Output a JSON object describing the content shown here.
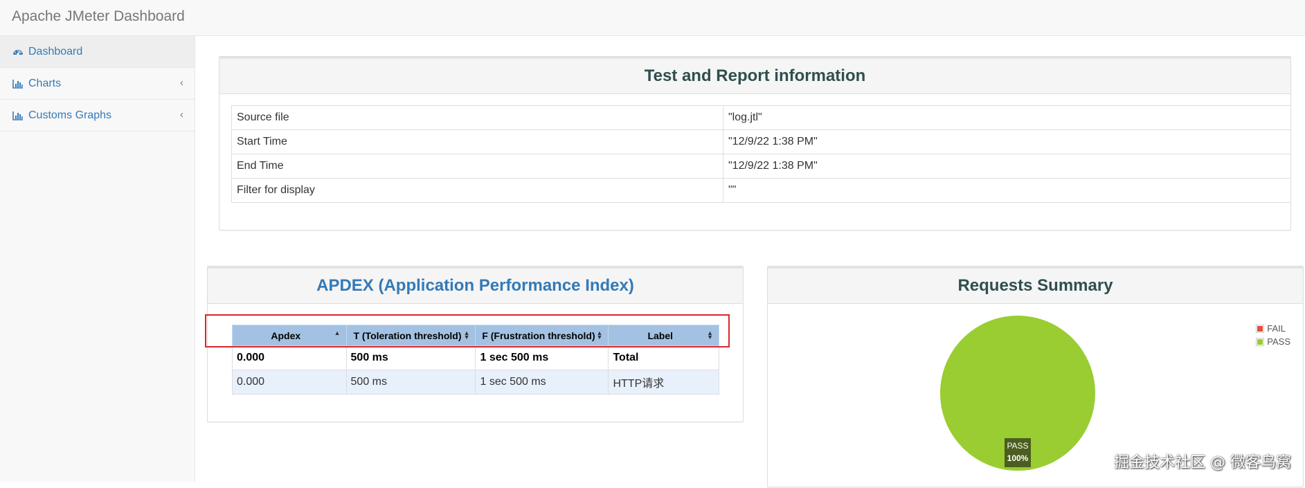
{
  "app": {
    "title": "Apache JMeter Dashboard"
  },
  "sidebar": {
    "items": [
      {
        "label": "Dashboard",
        "icon": "dashboard-icon",
        "active": true
      },
      {
        "label": "Charts",
        "icon": "bar-chart-icon",
        "chevron": "‹"
      },
      {
        "label": "Customs Graphs",
        "icon": "bar-chart-icon",
        "chevron": "‹"
      }
    ]
  },
  "test_info": {
    "title": "Test and Report information",
    "rows": [
      {
        "key": "Source file",
        "value": "\"log.jtl\""
      },
      {
        "key": "Start Time",
        "value": "\"12/9/22 1:38 PM\""
      },
      {
        "key": "End Time",
        "value": "\"12/9/22 1:38 PM\""
      },
      {
        "key": "Filter for display",
        "value": "\"\""
      }
    ]
  },
  "apdex": {
    "title": "APDEX (Application Performance Index)",
    "columns": [
      "Apdex",
      "T (Toleration threshold)",
      "F (Frustration threshold)",
      "Label"
    ],
    "rows": [
      [
        "0.000",
        "500 ms",
        "1 sec 500 ms",
        "Total"
      ],
      [
        "0.000",
        "500 ms",
        "1 sec 500 ms",
        "HTTP请求"
      ]
    ]
  },
  "requests_summary": {
    "title": "Requests Summary",
    "legend": [
      {
        "label": "FAIL",
        "color": "#e74c3c"
      },
      {
        "label": "PASS",
        "color": "#9acd32"
      }
    ],
    "slice_label": "PASS",
    "slice_percent": "100%"
  },
  "chart_data": {
    "type": "pie",
    "categories": [
      "FAIL",
      "PASS"
    ],
    "values": [
      0,
      100
    ],
    "colors": [
      "#e74c3c",
      "#9acd32"
    ],
    "title": "Requests Summary",
    "legend": "top-right"
  },
  "watermark": "掘金技术社区 @ 微客鸟窝"
}
